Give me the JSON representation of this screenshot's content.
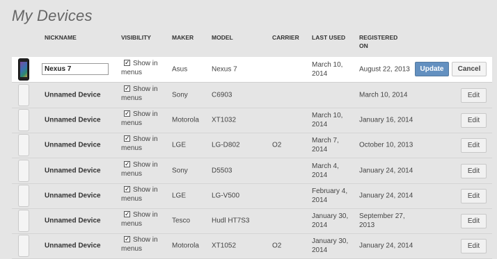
{
  "page_title": "My Devices",
  "columns": {
    "nickname": "NICKNAME",
    "visibility": "VISIBILITY",
    "maker": "MAKER",
    "model": "MODEL",
    "carrier": "CARRIER",
    "last_used": "LAST USED",
    "registered": "REGISTERED ON"
  },
  "edit_row": {
    "nickname_value": "Nexus 7",
    "visibility": "Show in menus",
    "visibility_checked": true,
    "maker": "Asus",
    "model": "Nexus 7",
    "carrier": "",
    "last_used": "March 10, 2014",
    "registered": "August 22, 2013",
    "update_label": "Update",
    "cancel_label": "Cancel"
  },
  "rows": [
    {
      "nickname": "Unnamed Device",
      "visibility": "Show in menus",
      "maker": "Sony",
      "model": "C6903",
      "carrier": "",
      "last_used": "",
      "registered": "March 10, 2014",
      "edit_label": "Edit"
    },
    {
      "nickname": "Unnamed Device",
      "visibility": "Show in menus",
      "maker": "Motorola",
      "model": "XT1032",
      "carrier": "",
      "last_used": "March 10, 2014",
      "registered": "January 16, 2014",
      "edit_label": "Edit"
    },
    {
      "nickname": "Unnamed Device",
      "visibility": "Show in menus",
      "maker": "LGE",
      "model": "LG-D802",
      "carrier": "O2",
      "last_used": "March 7, 2014",
      "registered": "October 10, 2013",
      "edit_label": "Edit"
    },
    {
      "nickname": "Unnamed Device",
      "visibility": "Show in menus",
      "maker": "Sony",
      "model": "D5503",
      "carrier": "",
      "last_used": "March 4, 2014",
      "registered": "January 24, 2014",
      "edit_label": "Edit"
    },
    {
      "nickname": "Unnamed Device",
      "visibility": "Show in menus",
      "maker": "LGE",
      "model": "LG-V500",
      "carrier": "",
      "last_used": "February 4, 2014",
      "registered": "January 24, 2014",
      "edit_label": "Edit"
    },
    {
      "nickname": "Unnamed Device",
      "visibility": "Show in menus",
      "maker": "Tesco",
      "model": "Hudl HT7S3",
      "carrier": "",
      "last_used": "January 30, 2014",
      "registered": "September 27, 2013",
      "edit_label": "Edit"
    },
    {
      "nickname": "Unnamed Device",
      "visibility": "Show in menus",
      "maker": "Motorola",
      "model": "XT1052",
      "carrier": "O2",
      "last_used": "January 30, 2014",
      "registered": "January 24, 2014",
      "edit_label": "Edit"
    }
  ]
}
